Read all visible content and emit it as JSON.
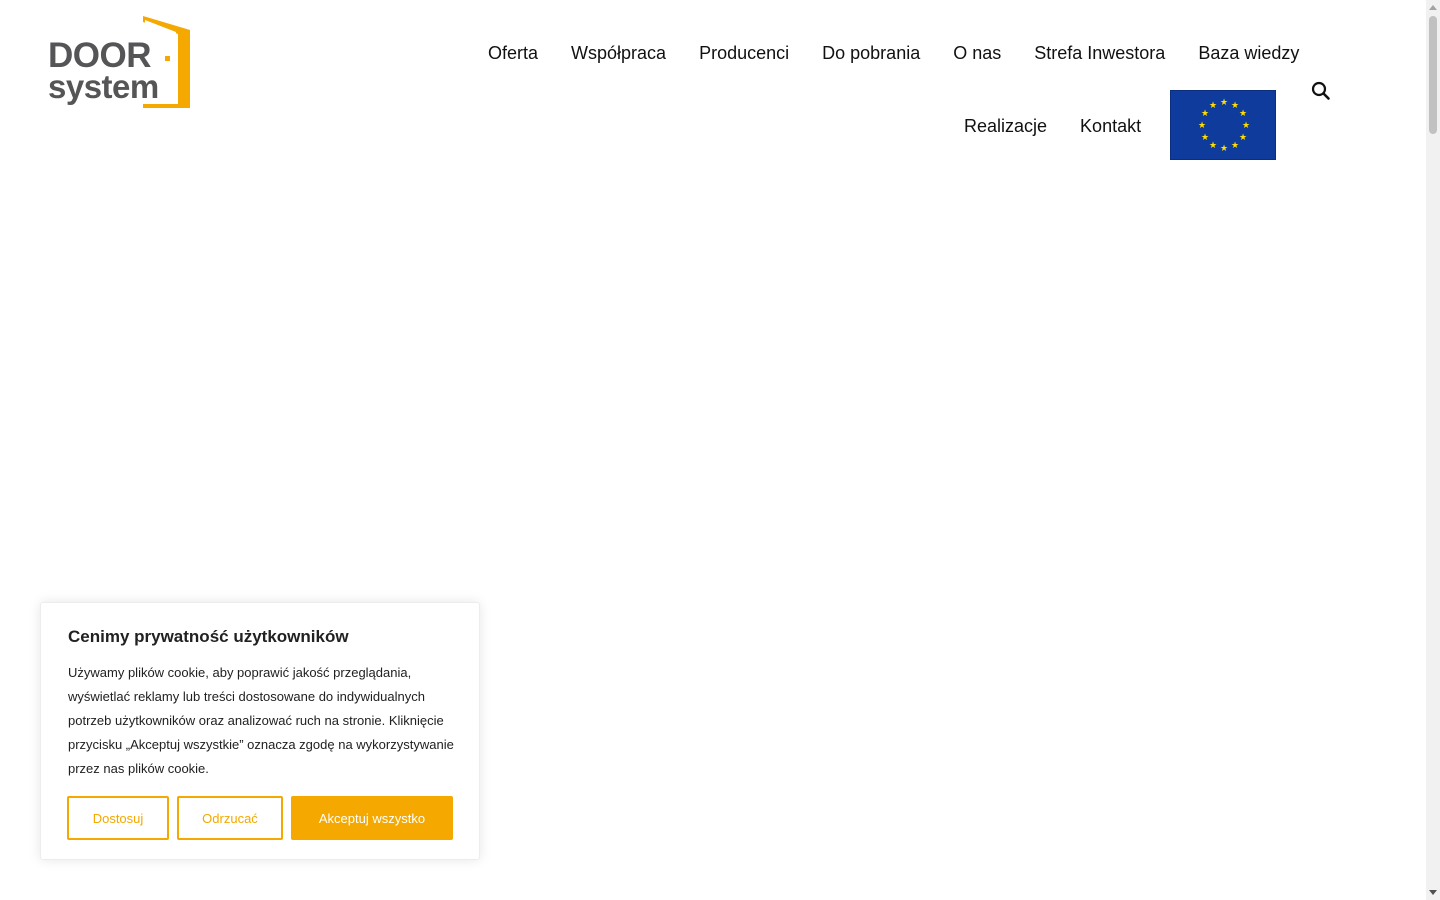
{
  "brand": {
    "logo_line1": "DOOR",
    "logo_line2": "system",
    "accent_color": "#F4A800",
    "text_color": "#555558"
  },
  "nav": {
    "row1": [
      {
        "label": "Oferta"
      },
      {
        "label": "Współpraca"
      },
      {
        "label": "Producenci"
      },
      {
        "label": "Do pobrania"
      },
      {
        "label": "O nas"
      },
      {
        "label": "Strefa Inwestora"
      },
      {
        "label": "Baza wiedzy"
      }
    ],
    "row2": [
      {
        "label": "Realizacje"
      },
      {
        "label": "Kontakt"
      }
    ],
    "eu_flag_icon": "eu-flag-icon",
    "search_icon": "search-icon"
  },
  "cookie": {
    "title": "Cenimy prywatność użytkowników",
    "body": "Używamy plików cookie, aby poprawić jakość przeglądania, wyświetlać reklamy lub treści dostosowane do indywidualnych potrzeb użytkowników oraz analizować ruch na stronie. Kliknięcie przycisku „Akceptuj wszystkie” oznacza zgodę na wykorzystywanie przez nas plików cookie.",
    "btn_customize": "Dostosuj",
    "btn_reject": "Odrzucać",
    "btn_accept": "Akceptuj wszystko"
  }
}
